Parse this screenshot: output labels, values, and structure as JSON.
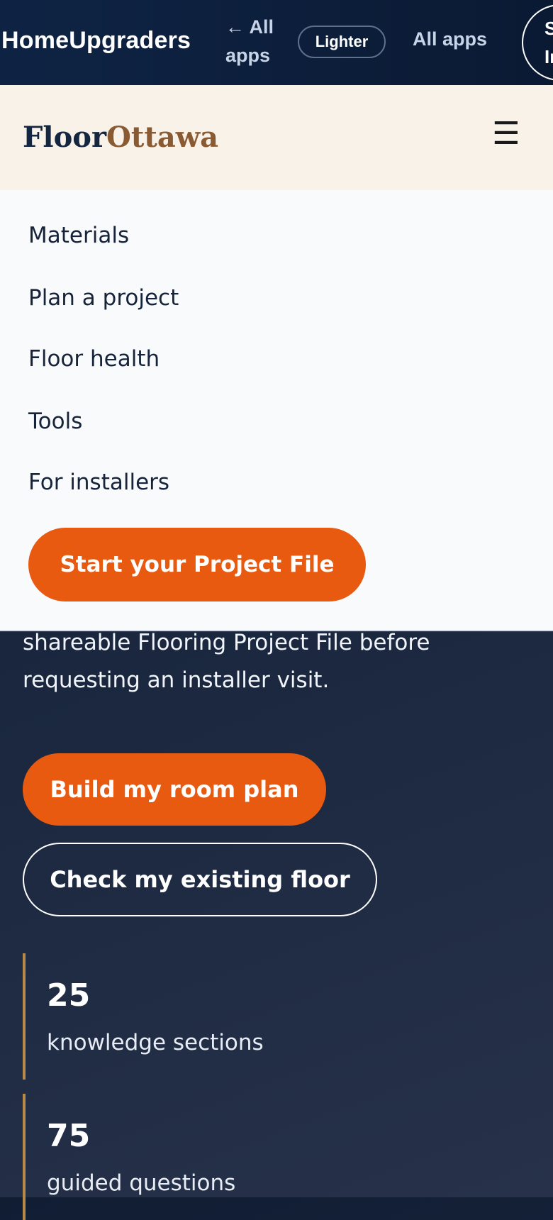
{
  "topbar": {
    "brand": "HomeUpgraders",
    "back_link": "← All apps",
    "theme_button": "Lighter",
    "all_apps": "All apps",
    "signin": "Sign In"
  },
  "site": {
    "logo_part1": "Floor",
    "logo_part2": "Ottawa",
    "menu_icon": "hamburger-icon",
    "colors": {
      "navy": "#152640",
      "brown": "#8a5a32",
      "orange": "#e85a10"
    }
  },
  "nav": {
    "items": [
      "Materials",
      "Plan a project",
      "Floor health",
      "Tools",
      "For installers"
    ],
    "cta": "Start your Project File"
  },
  "hero": {
    "text": "shareable Flooring Project File before requesting an installer visit.",
    "primary_button": "Build my room plan",
    "secondary_button": "Check my existing floor"
  },
  "stats": [
    {
      "value": "25",
      "label": "knowledge sections"
    },
    {
      "value": "75",
      "label": "guided questions"
    }
  ]
}
